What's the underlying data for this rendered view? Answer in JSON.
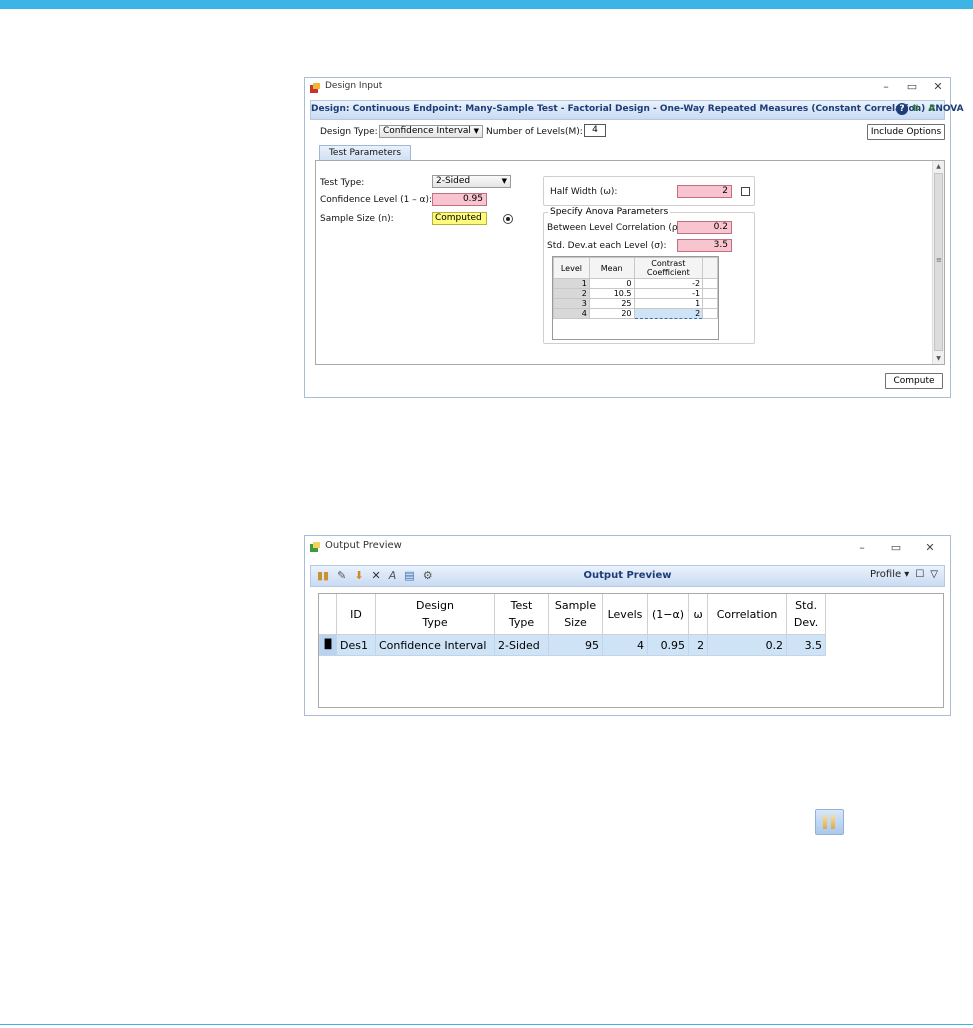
{
  "design_input": {
    "window_title": "Design Input",
    "header": "Design: Continuous Endpoint: Many-Sample Test - Factorial Design - One-Way Repeated Measures (Constant Correlation) ANOVA",
    "design_type_label": "Design Type:",
    "design_type_value": "Confidence Interval",
    "num_levels_label": "Number of Levels(M):",
    "num_levels_value": "4",
    "include_options_label": "Include Options",
    "tab_label": "Test Parameters",
    "test_type_label": "Test Type:",
    "test_type_value": "2-Sided",
    "confidence_label": "Confidence Level (1 – α):",
    "confidence_value": "0.95",
    "sample_size_label": "Sample Size (n):",
    "sample_size_value": "Computed",
    "half_width_label": "Half Width (ω):",
    "half_width_value": "2",
    "anova_group_title": "Specify Anova Parameters",
    "corr_label": "Between Level Correlation (ρ):",
    "corr_value": "0.2",
    "sd_label": "Std. Dev.at each Level (σ):",
    "sd_value": "3.5",
    "levels_table": {
      "headers": [
        "Level",
        "Mean",
        "Contrast Coefficient"
      ],
      "rows": [
        {
          "level": "1",
          "mean": "0",
          "coef": "-2"
        },
        {
          "level": "2",
          "mean": "10.5",
          "coef": "-1"
        },
        {
          "level": "3",
          "mean": "25",
          "coef": "1"
        },
        {
          "level": "4",
          "mean": "20",
          "coef": "2"
        }
      ]
    },
    "compute_label": "Compute"
  },
  "output_preview": {
    "window_title": "Output Preview",
    "toolbar_title": "Output Preview",
    "profile_label": "Profile",
    "columns": [
      {
        "l1": "ID",
        "l2": ""
      },
      {
        "l1": "Design",
        "l2": "Type"
      },
      {
        "l1": "Test",
        "l2": "Type"
      },
      {
        "l1": "Sample",
        "l2": "Size"
      },
      {
        "l1": "Levels",
        "l2": ""
      },
      {
        "l1": "(1−α)",
        "l2": ""
      },
      {
        "l1": "ω",
        "l2": ""
      },
      {
        "l1": "Correlation",
        "l2": ""
      },
      {
        "l1": "Std.",
        "l2": "Dev."
      }
    ],
    "row": {
      "id": "Des1",
      "design_type": "Confidence Interval",
      "test_type": "2-Sided",
      "sample_size": "95",
      "levels": "4",
      "conf": "0.95",
      "omega": "2",
      "correlation": "0.2",
      "sd": "3.5"
    }
  },
  "colors": {
    "accent": "#3cb4e6",
    "header_text": "#1d3c78",
    "required_field": "#f7c4cf",
    "computed_field": "#fdfa7c",
    "selected_row": "#cfe3f7"
  }
}
